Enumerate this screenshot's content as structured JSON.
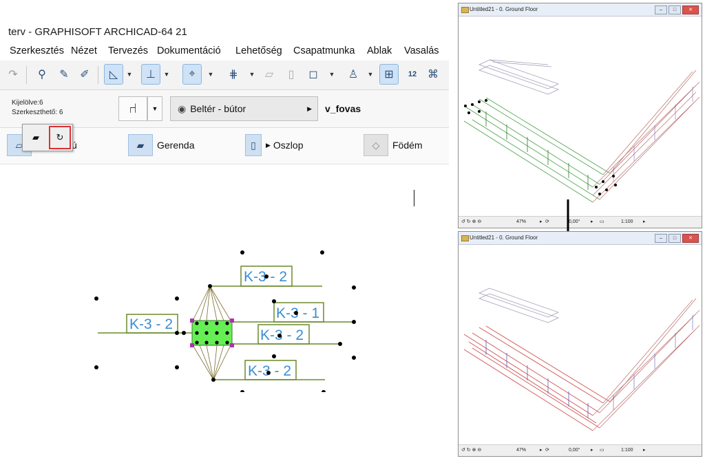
{
  "app": {
    "title": "terv - GRAPHISOFT ARCHICAD-64 21",
    "menus": [
      "Szerkesztés",
      "Nézet",
      "Tervezés",
      "Dokumentáció",
      "Lehetőség",
      "Csapatmunka",
      "Ablak",
      "Vasalás"
    ],
    "selection": {
      "selected": "Kijelölve:6",
      "editable": "Szerkeszthető: 6"
    },
    "layer": "Beltér - bútor",
    "layer_name": "v_fovas",
    "tools": [
      {
        "label": "ú",
        "icon": "wall-icon"
      },
      {
        "label": "Gerenda",
        "icon": "beam-icon"
      },
      {
        "label": "Oszlop",
        "icon": "column-icon"
      },
      {
        "label": "Födém",
        "icon": "slab-icon"
      }
    ]
  },
  "plan": {
    "labels": [
      "K-3 - 2",
      "K-3 - 2",
      "K-3 - 1",
      "K-3 - 2",
      "K-3 - 2"
    ],
    "accent": "#6a8a2a",
    "highlight": "#66ee55"
  },
  "windows3d": [
    {
      "title": "Untitled21 - 0. Ground Floor",
      "zoom": "47%",
      "angle": "0,00°",
      "scale": "1:100",
      "state": "before"
    },
    {
      "title": "Untitled21 - 0. Ground Floor",
      "zoom": "47%",
      "angle": "0,00°",
      "scale": "1:100",
      "state": "after"
    }
  ]
}
